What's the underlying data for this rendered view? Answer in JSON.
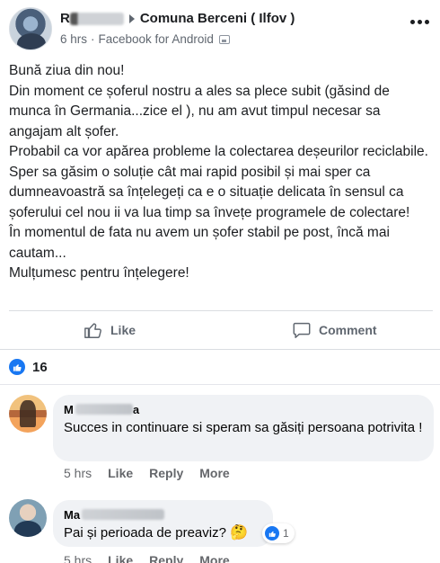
{
  "post": {
    "author_prefix": "R",
    "group": "Comuna Berceni ( Ilfov )",
    "time": "6 hrs",
    "separator": "·",
    "source": "Facebook for Android",
    "body": [
      "Bună ziua din nou!",
      "Din moment ce șoferul nostru a ales sa plece subit (găsind de munca în Germania...zice el ), nu am avut timpul necesar sa angajam alt șofer.",
      "Probabil ca vor apărea probleme la colectarea deșeurilor reciclabile.",
      "Sper sa găsim o soluție cât mai rapid posibil și mai sper ca dumneavoastră sa înțelegeți ca e o situație delicata în sensul ca șoferului cel nou ii va lua timp sa învețe programele de colectare!",
      "În momentul de fata nu avem un șofer stabil pe post, încă mai cautam...",
      "Mulțumesc pentru înțelegere!"
    ]
  },
  "actions": {
    "like_label": "Like",
    "comment_label": "Comment"
  },
  "reactions": {
    "count": "16"
  },
  "comments": [
    {
      "name_prefix": "M",
      "name_suffix": "a",
      "text": "Succes in continuare si speram sa găsiți persoana potrivita !",
      "time": "5 hrs",
      "like": "Like",
      "reply": "Reply",
      "more": "More"
    },
    {
      "name_prefix": "Ma",
      "text": "Pai și perioada de preaviz? ",
      "emoji": "🤔",
      "reaction_count": "1",
      "time": "5 hrs",
      "like": "Like",
      "reply": "Reply",
      "more": "More"
    }
  ],
  "colors": {
    "accent": "#1877f2",
    "muted": "#606770",
    "bubble": "#f0f2f5"
  }
}
